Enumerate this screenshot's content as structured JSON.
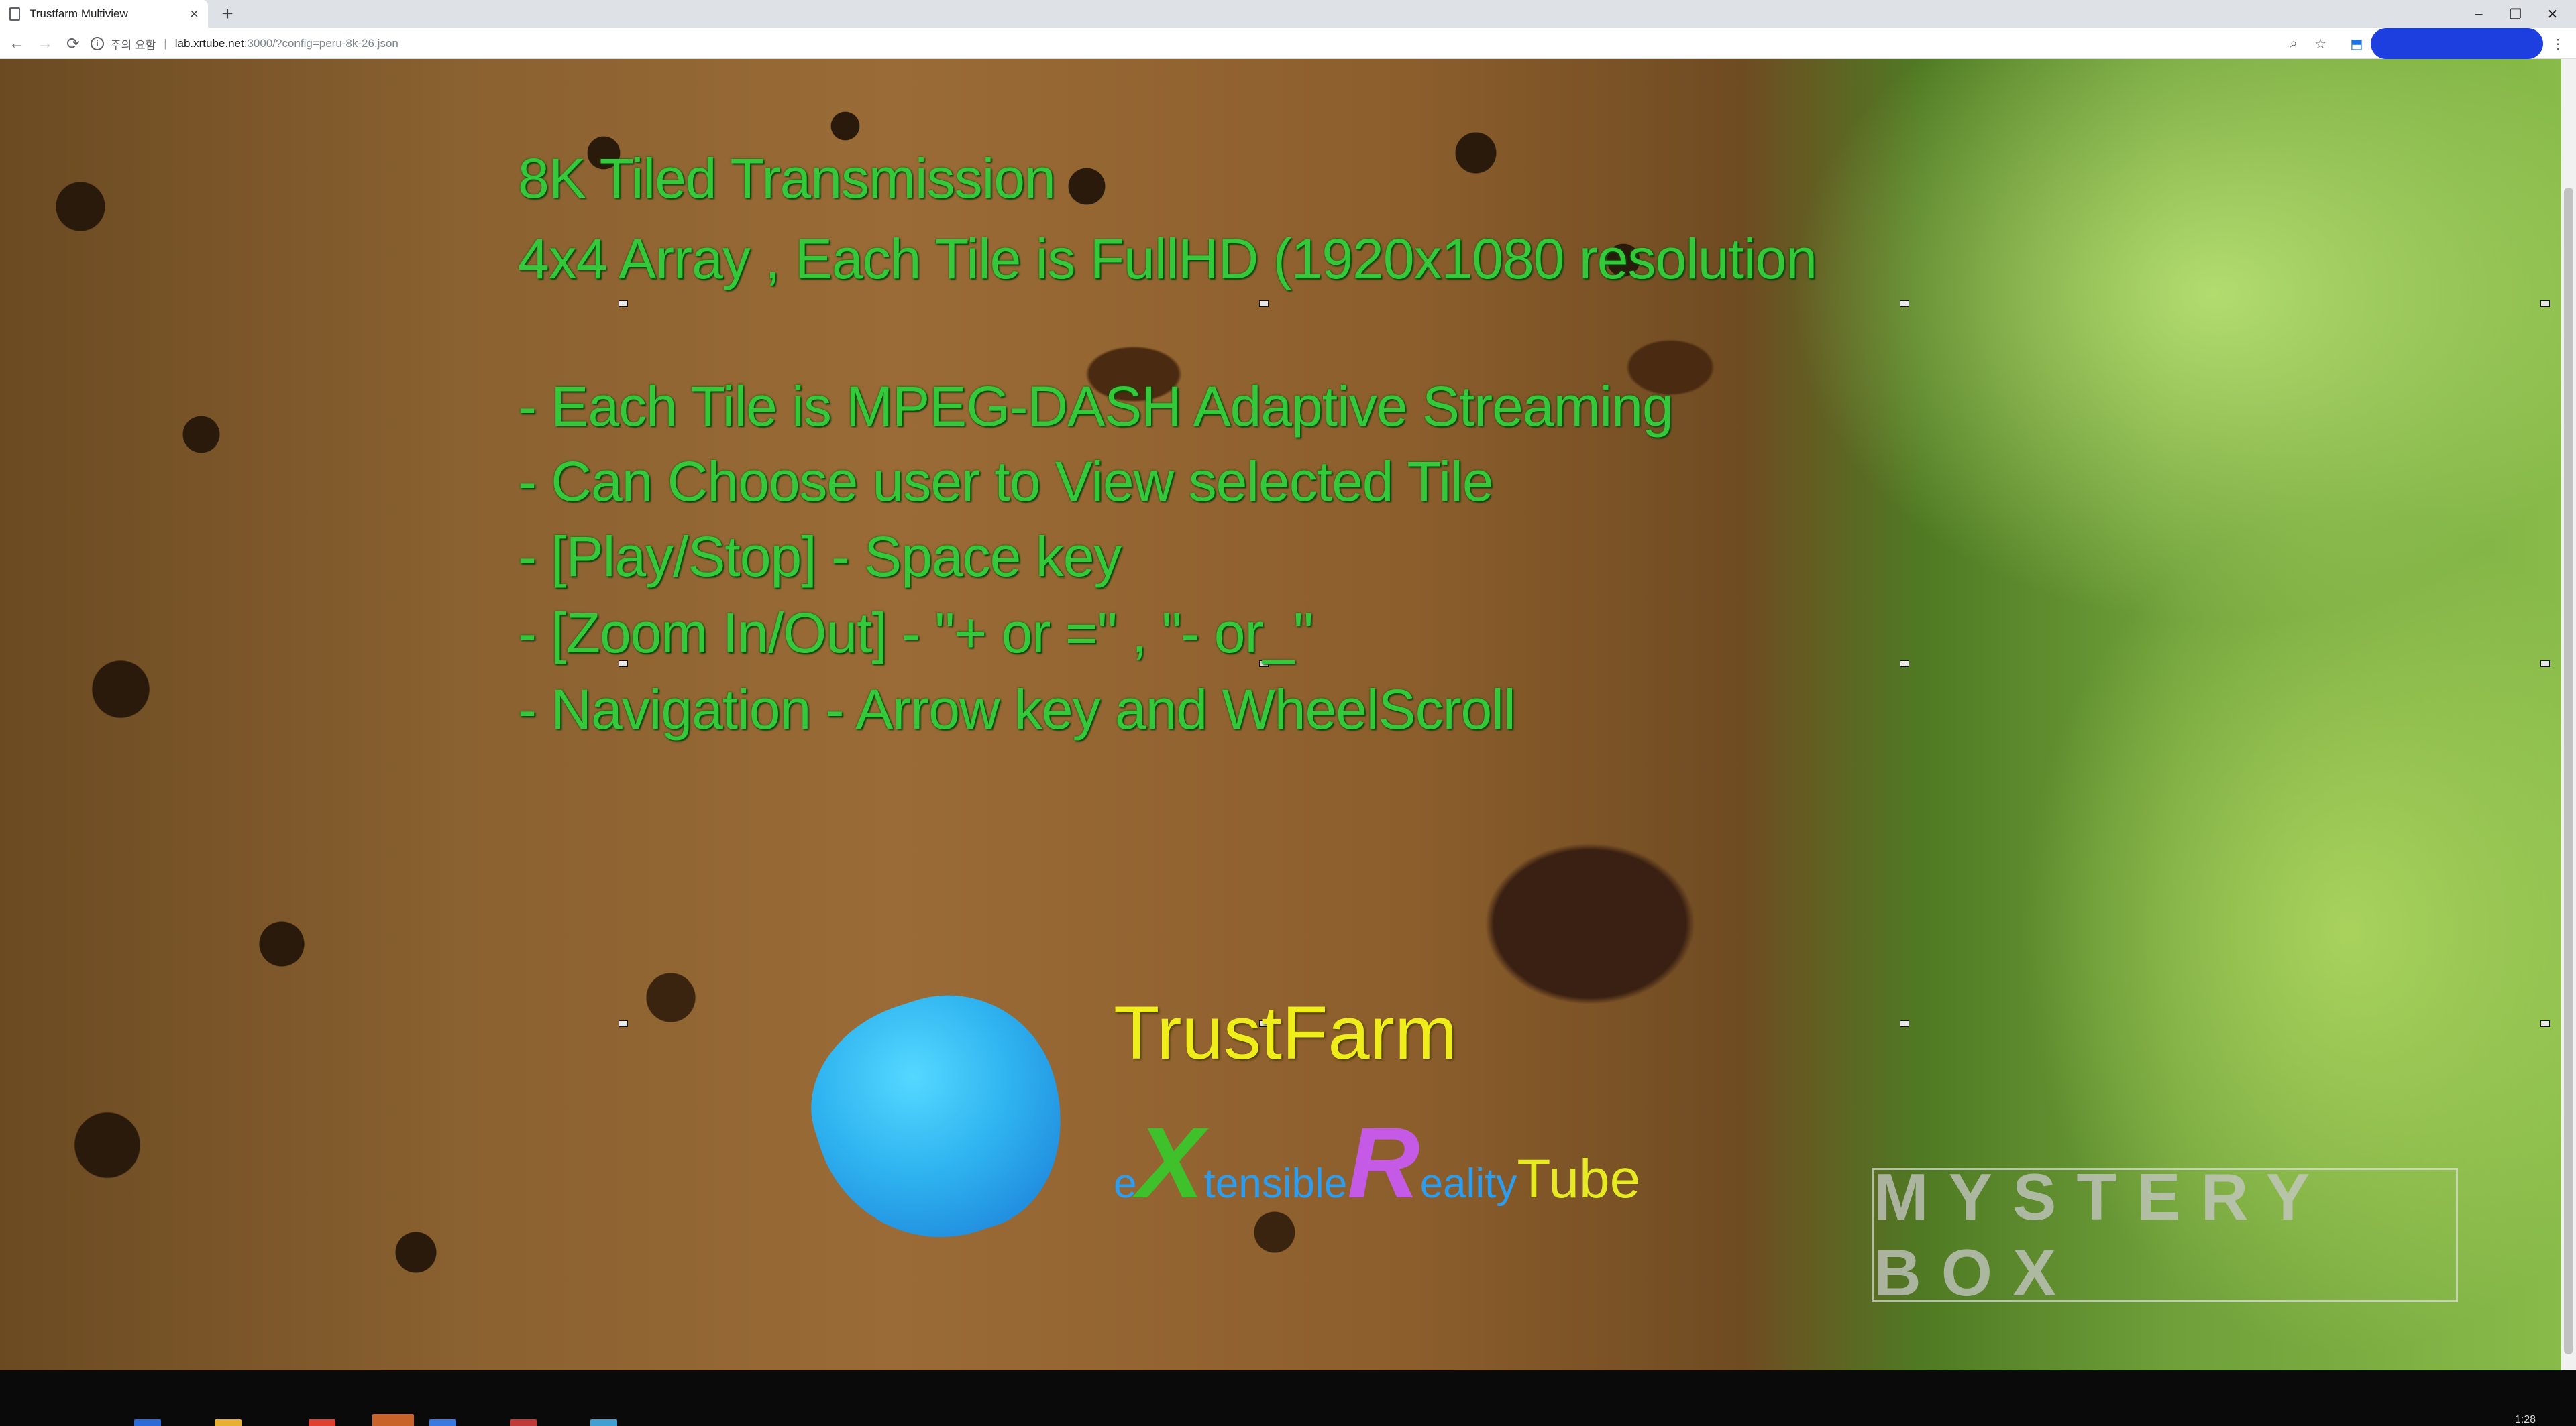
{
  "browser": {
    "tab_title": "Trustfarm Multiview",
    "new_tab_glyph": "+",
    "address": {
      "security_label": "주의 요함",
      "separator": "|",
      "url_host": "lab.xrtube.net",
      "url_rest": ":3000/?config=peru-8k-26.json"
    },
    "window_controls": [
      "–",
      "❐",
      "✕"
    ]
  },
  "content": {
    "info_lines": [
      "8K Tiled Transmission",
      "4x4 Array , Each Tile is FullHD (1920x1080 resolution",
      "- Each Tile is MPEG-DASH Adaptive Streaming",
      "- Can Choose user to View selected Tile",
      "- [Play/Stop]  - Space key",
      "- [Zoom In/Out] - \"+ or =\" , \"- or_\"",
      "- Navigation  - Arrow key and WheelScroll"
    ],
    "brand": {
      "title": "TrustFarm",
      "subtitle_parts": [
        "e",
        "X",
        "tensible",
        "R",
        "eality",
        "Tube"
      ]
    },
    "watermark": "MYSTERY BOX"
  },
  "taskbar": {
    "clock_time": "1:28"
  }
}
